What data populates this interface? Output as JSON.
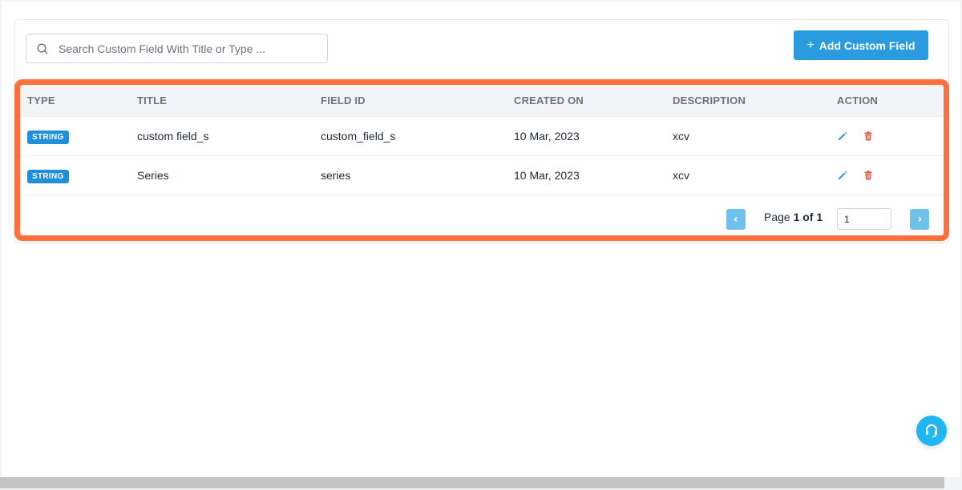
{
  "search": {
    "placeholder": "Search Custom Field With Title or Type ..."
  },
  "toolbar": {
    "add_label": "Add Custom Field"
  },
  "table": {
    "columns": [
      "TYPE",
      "TITLE",
      "FIELD ID",
      "CREATED ON",
      "DESCRIPTION",
      "ACTION"
    ],
    "rows": [
      {
        "type": "STRING",
        "title": "custom field_s",
        "field_id": "custom_field_s",
        "created_on": "10 Mar, 2023",
        "description": "xcv"
      },
      {
        "type": "STRING",
        "title": "Series",
        "field_id": "series",
        "created_on": "10 Mar, 2023",
        "description": "xcv"
      }
    ]
  },
  "pagination": {
    "page_word": "Page",
    "current_of_total": "1 of 1",
    "page_input_value": "1"
  },
  "colors": {
    "accent": "#2a9bdf",
    "highlight": "#ff6f3c",
    "badge": "#1e8fd8",
    "delete": "#e8533a"
  }
}
